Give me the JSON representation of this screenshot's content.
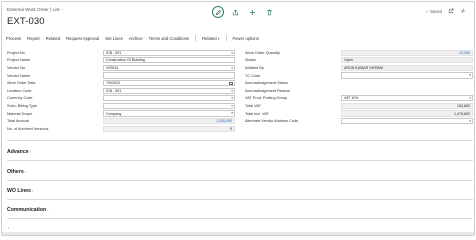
{
  "breadcrumb": {
    "text": "External Work Order | List",
    "chevron": "‹"
  },
  "page_title": "EXT-030",
  "header": {
    "saved_label": "✓ Saved"
  },
  "actions": {
    "items": [
      "Process",
      "Report",
      "Related",
      "Request Approval",
      "Set Lines",
      "Archive",
      "Terms and Conditions"
    ],
    "related_label": "Related",
    "fewer_options": "Fewer options"
  },
  "fields_left": [
    {
      "label": "Project No.",
      "value": "ICB - 001",
      "dropdown": true
    },
    {
      "label": "Project Name",
      "value": "Construction Of Building"
    },
    {
      "label": "Vendor No.",
      "value": "V00014",
      "dropdown": true
    },
    {
      "label": "Vendor Name",
      "value": ""
    },
    {
      "label": "Work Order Date",
      "value": "7/9/2024",
      "calendar": true
    },
    {
      "label": "Location Code",
      "value": "ICB - 001",
      "dropdown": true
    },
    {
      "label": "Currency Code",
      "value": "",
      "dropdown": true
    },
    {
      "label": "Subc. Billing Type",
      "value": "",
      "dropdown": true
    },
    {
      "label": "Material Scope",
      "value": "Company",
      "dropdown": true
    },
    {
      "label": "Total Amount",
      "value": "1,326,000",
      "readonly": true,
      "numeric": true,
      "blue": true
    },
    {
      "label": "No. of Archived Versions",
      "value": "0",
      "readonly": true,
      "numeric": true
    }
  ],
  "fields_right": [
    {
      "label": "Work Order Quantity",
      "value": "13,263",
      "readonly": true,
      "numeric": true,
      "blue": true
    },
    {
      "label": "Status",
      "value": "Open",
      "readonly": true
    },
    {
      "label": "Initiated By",
      "value": "ARUN KUMAR VIKRAM",
      "readonly": true
    },
    {
      "label": "TC Code",
      "value": "",
      "dropdown": true
    },
    {
      "label": "Acknowledgement Status",
      "value": "",
      "plain": true
    },
    {
      "label": "Acknowledgement Reason",
      "value": "",
      "plain": true
    },
    {
      "label": "VAT Prod. Posting Group",
      "value": "VAT 10%",
      "dropdown": true
    },
    {
      "label": "Total VAT",
      "value": "153,600",
      "readonly": true,
      "numeric": true
    },
    {
      "label": "Total Incl. VAT",
      "value": "1,479,600",
      "readonly": true,
      "numeric": true
    },
    {
      "label": "Alternate Vendor Address Code",
      "value": "",
      "dropdown": true
    }
  ],
  "sections": [
    {
      "label": "Advance"
    },
    {
      "label": "Others"
    },
    {
      "label": "WO Lines"
    },
    {
      "label": "Communication"
    }
  ],
  "icons": {
    "edit": "pencil-icon",
    "share": "share-icon",
    "add": "plus-icon",
    "delete": "trash-icon"
  }
}
